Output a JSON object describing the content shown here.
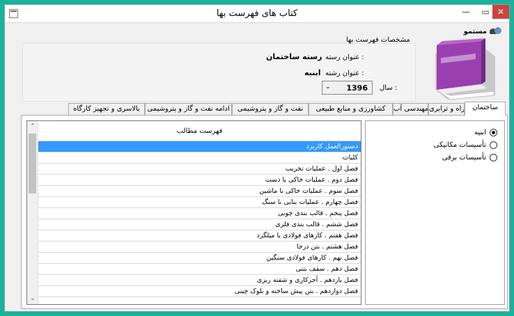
{
  "window": {
    "title": "کتاب های فهرست بها",
    "minimize_glyph": "—",
    "maximize_glyph": "▭",
    "close_glyph": "✕"
  },
  "user": {
    "name": "مستمو"
  },
  "header": {
    "caption": "مشخصات فهرست بها",
    "field_label": "عنوان رسته :",
    "field_value": "رسته ساختمان",
    "branch_label": "عنوان رشته :",
    "branch_value": "ابنیه",
    "year_label": "سال :",
    "year_value": "1396",
    "year_arrow": "⌄"
  },
  "tabs": [
    {
      "label": "ساختمان",
      "active": true
    },
    {
      "label": "راه و ترابری",
      "active": false
    },
    {
      "label": "مهندسی آب",
      "active": false
    },
    {
      "label": "کشاورزی و منابع طبیعی",
      "active": false
    },
    {
      "label": "نفت و گاز و پتروشیمی",
      "active": false
    },
    {
      "label": "ادامه نفت و گاز و پتروشیمی",
      "active": false
    },
    {
      "label": "بالاسری و تجهیز کارگاه",
      "active": false
    }
  ],
  "list": {
    "column_header": "فهرست مطالب",
    "rows": [
      "دستورالعمل کاربرد",
      "کلیات",
      "فصل اول . عملیات تخریب",
      "فصل دوم . عملیات خاکی با دست",
      "فصل سوم . عملیات خاکی با ماشین",
      "فصل چهارم . عملیات بنایی با سنگ",
      "فصل پنجم . قالب بندی چوبی",
      "فصل ششم . قالب بندی فلزی",
      "فصل هفتم . کارهای فولادی با میلگرد",
      "فصل هشتم . بتن درجا",
      "فصل نهم . کارهای فولادی سنگین",
      "فصل دهم . سقف بتنی",
      "فصل یازدهم . آجرکاری و شفته ریزی",
      "فصل دوازدهم . بتن پیش ساخته و بلوک چینی"
    ],
    "selected_index": 0,
    "scroll_up": "⌃",
    "scroll_down": "⌄"
  },
  "categories": [
    {
      "label": "ابنیه",
      "checked": true
    },
    {
      "label": "تأسیسات مکانیکی",
      "checked": false
    },
    {
      "label": "تأسیسات برقی",
      "checked": false
    }
  ],
  "colors": {
    "background": "#1bb29c",
    "selection": "#3399ff",
    "book_purple": "#9a3fb0",
    "close_button": "#c7463f"
  }
}
